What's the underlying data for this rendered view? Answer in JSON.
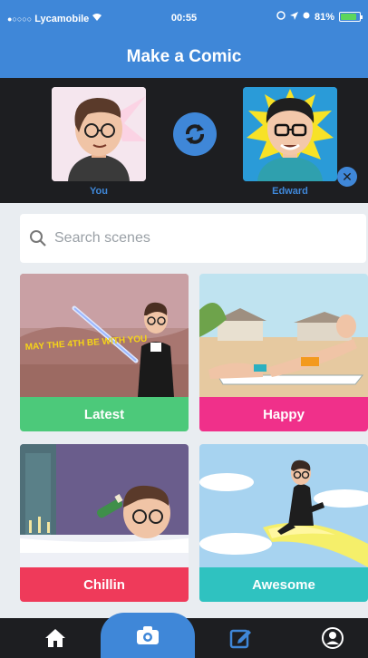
{
  "status_bar": {
    "carrier": "Lycamobile",
    "time": "00:55",
    "battery": "81%"
  },
  "header": {
    "title": "Make a Comic"
  },
  "friends": {
    "you_label": "You",
    "friend_label": "Edward"
  },
  "search": {
    "placeholder": "Search scenes"
  },
  "scenes": [
    {
      "label": "Latest",
      "color": "#4cc97a",
      "caption": "MAY THE 4TH BE WITH YOU"
    },
    {
      "label": "Happy",
      "color": "#f0308a"
    },
    {
      "label": "Chillin",
      "color": "#ef3a5a"
    },
    {
      "label": "Awesome",
      "color": "#2fc2c0"
    }
  ],
  "colors": {
    "brand_blue": "#3f87d8",
    "dark_panel": "#1d1e21",
    "background": "#e9edf1"
  },
  "tab_bar": {
    "icons": [
      "home-icon",
      "camera-icon",
      "compose-icon",
      "profile-icon"
    ],
    "active": "camera"
  }
}
